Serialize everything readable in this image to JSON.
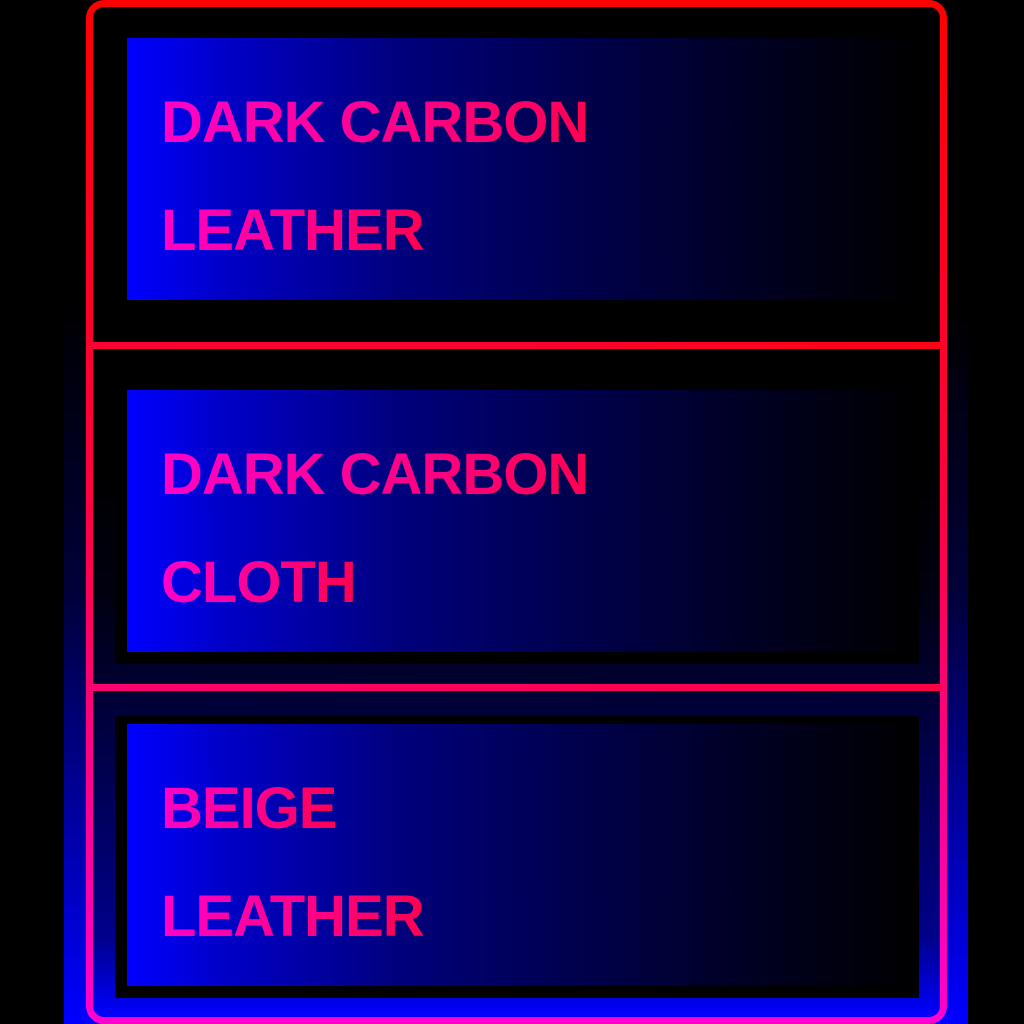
{
  "colors": {
    "background": "#000000",
    "frame_top": "#ff0000",
    "frame_bottom": "#ff00d0",
    "card_gradient_start": "#0000ff",
    "card_gradient_end": "#000000",
    "text_gradient_start": "#ff00c8",
    "text_gradient_end": "#ff0050"
  },
  "options": [
    {
      "line1": "DARK CARBON",
      "line2": "LEATHER"
    },
    {
      "line1": "DARK CARBON",
      "line2": "CLOTH"
    },
    {
      "line1": "BEIGE",
      "line2": "LEATHER"
    }
  ]
}
